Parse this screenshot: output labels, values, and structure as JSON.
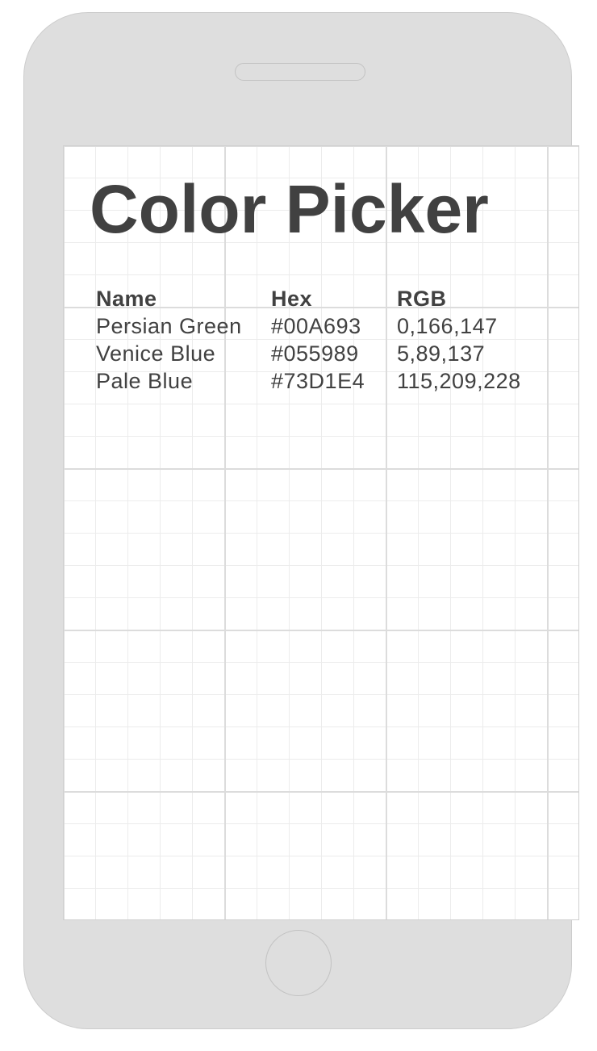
{
  "page": {
    "title": "Color Picker"
  },
  "table": {
    "headers": {
      "name": "Name",
      "hex": "Hex",
      "rgb": "RGB"
    },
    "rows": [
      {
        "name": "Persian Green",
        "hex": "#00A693",
        "rgb": "0,166,147"
      },
      {
        "name": "Venice Blue",
        "hex": "#055989",
        "rgb": "5,89,137"
      },
      {
        "name": "Pale Blue",
        "hex": "#73D1E4",
        "rgb": "115,209,228"
      }
    ]
  },
  "colors": {
    "device_frame": "#dedede",
    "text": "#414141",
    "screen_background": "#ffffff",
    "grid_line": "#ececec"
  }
}
